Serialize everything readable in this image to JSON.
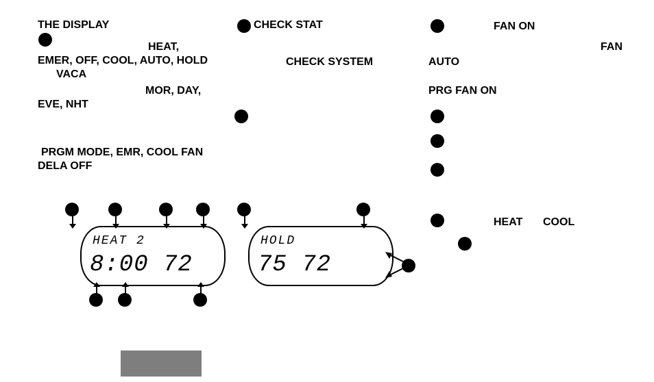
{
  "left": {
    "title": "THE DISPLAY",
    "line1": "HEAT,",
    "line2": "EMER, OFF, COOL, AUTO, HOLD",
    "line3": "VACA",
    "line4": "MOR, DAY,",
    "line5": "EVE, NHT",
    "line6": "PRGM MODE, EMR, COOL FAN",
    "line7": "DELA OFF"
  },
  "center": {
    "check_stat": "CHECK STAT",
    "check_system": "CHECK SYSTEM"
  },
  "right": {
    "fan_on": "FAN ON",
    "fan": "FAN",
    "auto": "AUTO",
    "prg_fan_on": "PRG FAN ON",
    "heat": "HEAT",
    "cool": "COOL"
  },
  "lcd1": {
    "row1": "HEAT 2",
    "row2": "8:00  72"
  },
  "lcd2": {
    "row1": "HOLD",
    "row2": " 75   72"
  }
}
